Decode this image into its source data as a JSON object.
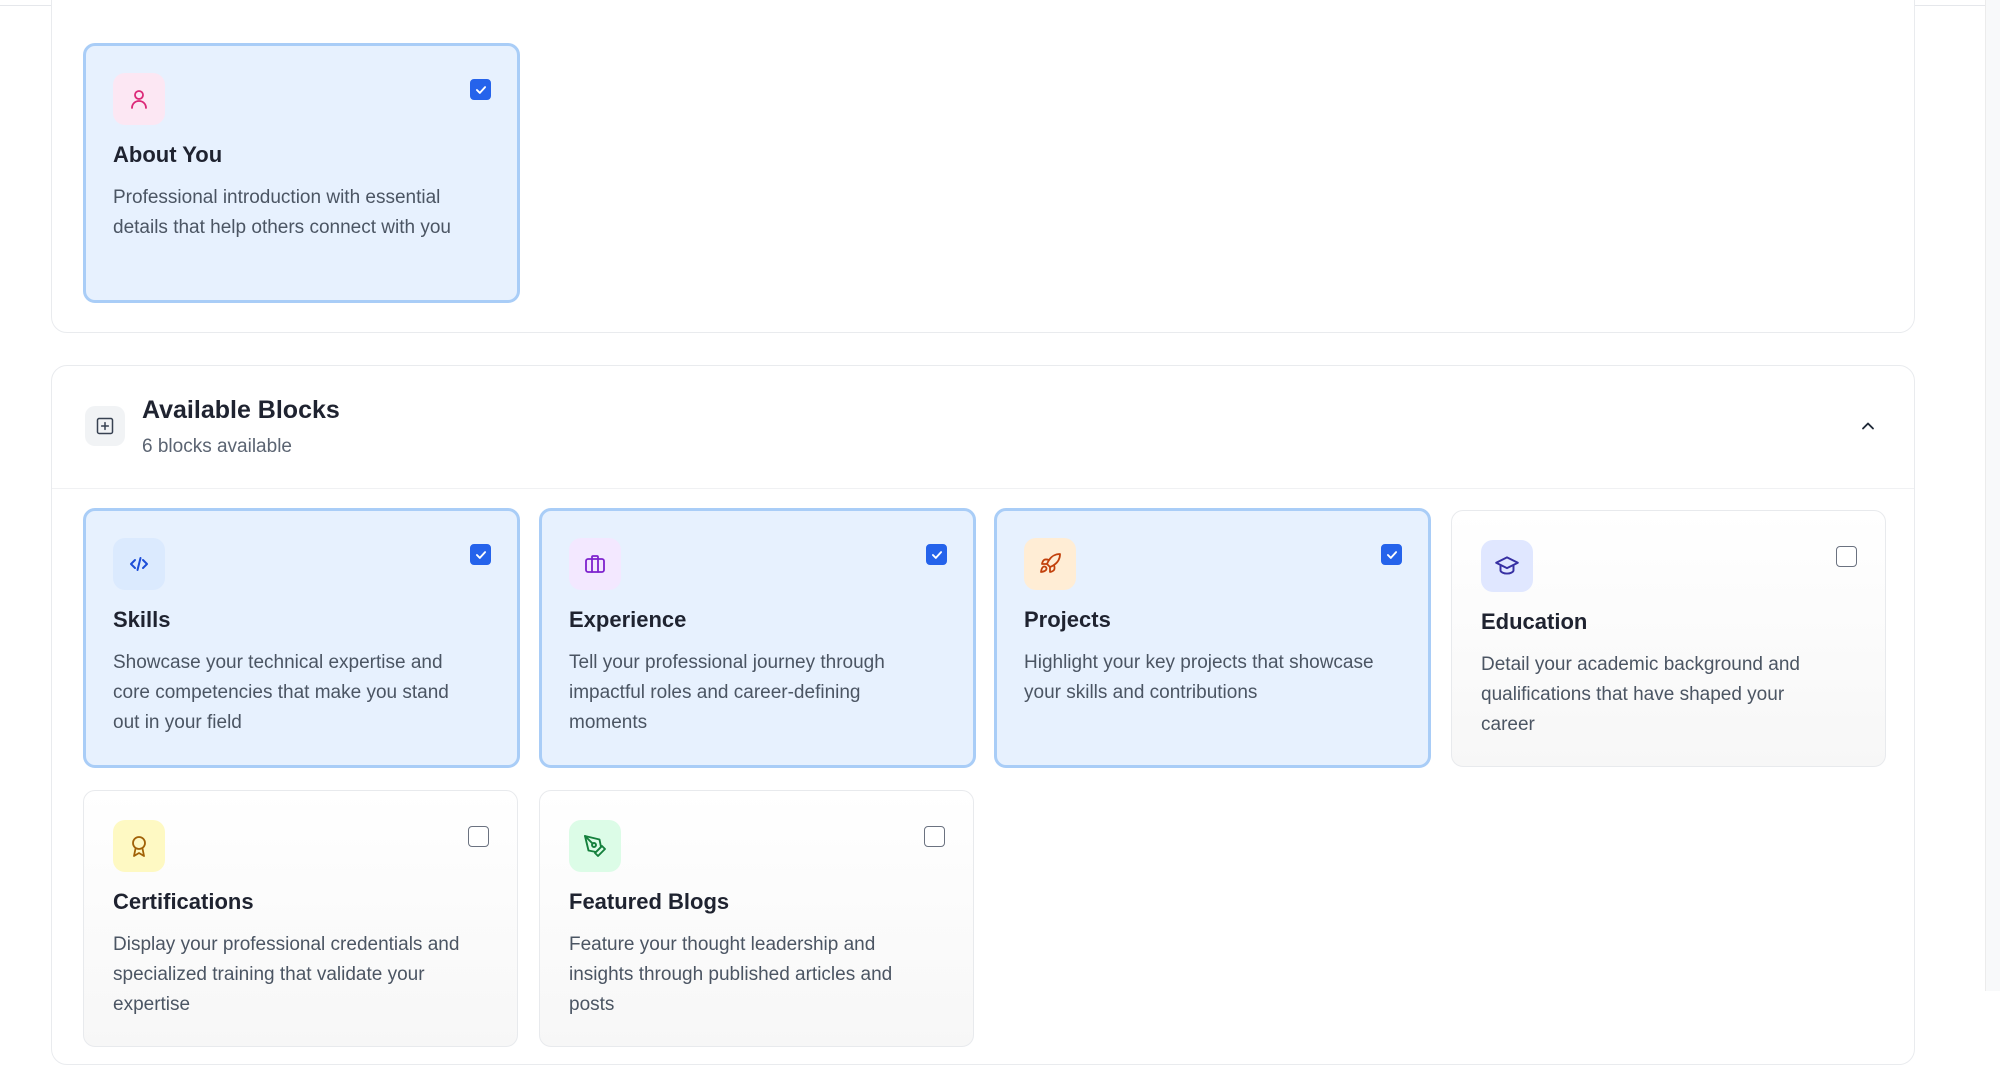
{
  "selected_section": {
    "cards": [
      {
        "title": "About You",
        "description": "Professional introduction with essential details that help others connect with you",
        "checked": true,
        "icon": "user-icon",
        "icon_bg": "#fce7f3",
        "icon_color": "#db2777"
      }
    ]
  },
  "available_blocks": {
    "title": "Available Blocks",
    "subtitle": "6 blocks available",
    "cards": [
      {
        "title": "Skills",
        "description": "Showcase your technical expertise and core competencies that make you stand out in your field",
        "checked": true,
        "icon": "code-icon",
        "icon_bg": "#dbeafe",
        "icon_color": "#1d4ed8"
      },
      {
        "title": "Experience",
        "description": "Tell your professional journey through impactful roles and career-defining moments",
        "checked": true,
        "icon": "briefcase-icon",
        "icon_bg": "#f3e8ff",
        "icon_color": "#7e22ce"
      },
      {
        "title": "Projects",
        "description": "Highlight your key projects that showcase your skills and contributions",
        "checked": true,
        "icon": "rocket-icon",
        "icon_bg": "#ffedd5",
        "icon_color": "#c2410c"
      },
      {
        "title": "Education",
        "description": "Detail your academic background and qualifications that have shaped your career",
        "checked": false,
        "icon": "graduation-cap-icon",
        "icon_bg": "#e0e7ff",
        "icon_color": "#3730a3"
      },
      {
        "title": "Certifications",
        "description": "Display your professional credentials and specialized training that validate your expertise",
        "checked": false,
        "icon": "award-icon",
        "icon_bg": "#fef9c3",
        "icon_color": "#a16207"
      },
      {
        "title": "Featured Blogs",
        "description": "Feature your thought leadership and insights through published articles and posts",
        "checked": false,
        "icon": "pen-tool-icon",
        "icon_bg": "#dcfce7",
        "icon_color": "#15803d"
      }
    ]
  }
}
